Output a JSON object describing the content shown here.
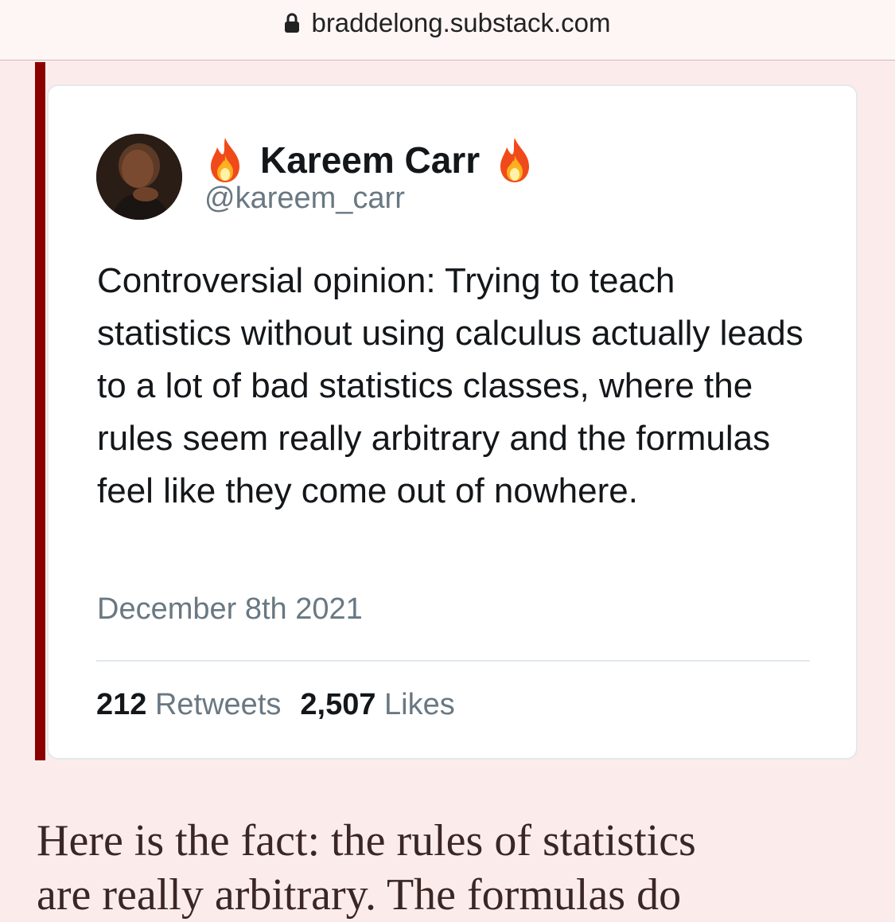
{
  "browser": {
    "url": "braddelong.substack.com",
    "icons": {
      "lock": "lock-icon"
    }
  },
  "colors": {
    "page_background": "#fbeceb",
    "quote_bar": "#8b0000",
    "card_background": "#ffffff",
    "muted_text": "#697882",
    "body_text": "#3b2626"
  },
  "tweet": {
    "name_icon": "fire-icon",
    "display_name": "Kareem Carr",
    "handle": "@kareem_carr",
    "text": "Controversial opinion: Trying to teach statistics without using calculus actually leads to a lot of bad statistics classes, where the rules seem really arbitrary and the formulas feel like they come out of nowhere.",
    "date": "December 8th 2021",
    "retweets_count": "212",
    "retweets_label": "Retweets",
    "likes_count": "2,507",
    "likes_label": "Likes"
  },
  "article": {
    "paragraph_line_1": "Here is the fact: the rules of statistics",
    "paragraph_line_2_partial": "are really arbitrary. The formulas do"
  }
}
